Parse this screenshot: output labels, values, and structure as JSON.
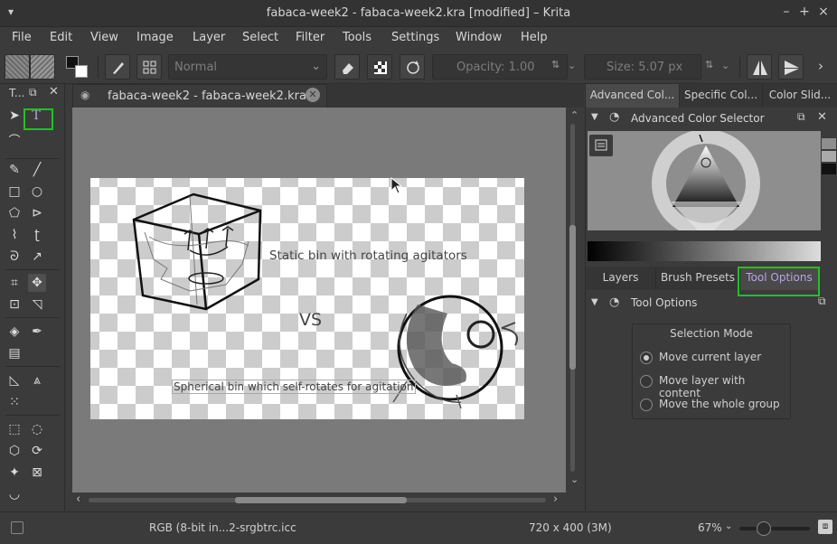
{
  "window": {
    "title": "fabaca-week2 - fabaca-week2.kra [modified] – Krita",
    "controls": [
      "–",
      "+",
      "×"
    ]
  },
  "menubar": [
    "File",
    "Edit",
    "View",
    "Image",
    "Layer",
    "Select",
    "Filter",
    "Tools",
    "Settings",
    "Window",
    "Help"
  ],
  "toolbar": {
    "blend_mode": "Normal",
    "opacity": "Opacity:  1.00",
    "size": "Size:  5.07 px"
  },
  "toolbox": {
    "title": "T..."
  },
  "document": {
    "tab_title": "fabaca-week2 - fabaca-week2.kra",
    "canvas_texts": {
      "static_bin": "Static bin with rotating agitators",
      "vs": "VS",
      "spherical_bin": "Spherical bin which self-rotates for agitation"
    }
  },
  "right_dock": {
    "top_tabs": [
      "Advanced Col...",
      "Specific Col...",
      "Color Slid..."
    ],
    "color_selector_title": "Advanced Color Selector",
    "bottom_tabs": [
      "Layers",
      "Brush Presets",
      "Tool Options"
    ],
    "tool_options_title": "Tool Options",
    "selection_mode": {
      "title": "Selection Mode",
      "options": [
        "Move current layer",
        "Move layer with content",
        "Move the whole group"
      ],
      "selected_index": 0
    }
  },
  "statusbar": {
    "color_profile": "RGB (8-bit in...2-srgbtrc.icc",
    "dimensions": "720 x 400 (3M)",
    "zoom": "67%",
    "zoom_fraction": 0.3
  },
  "colors": {
    "highlight": "#22c02a",
    "active_tab_text": "#b9a4e6"
  }
}
